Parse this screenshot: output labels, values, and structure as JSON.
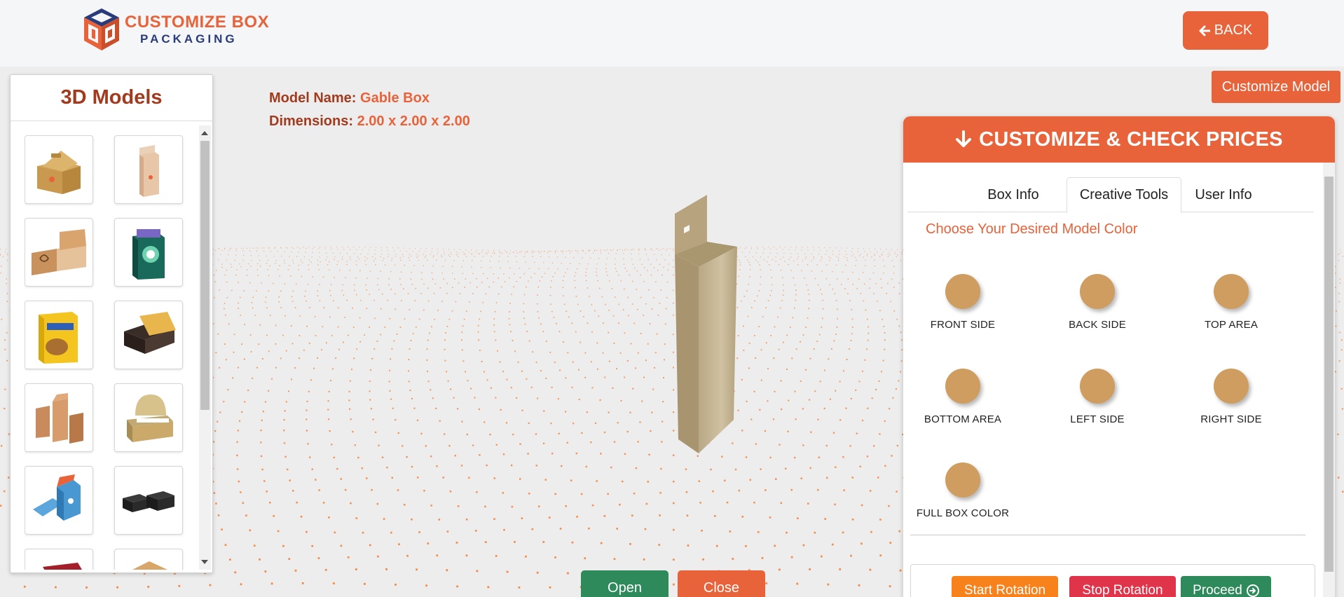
{
  "header": {
    "logo_line1": "CUSTOMIZE BOX",
    "logo_line2": "PACKAGING",
    "back_label": "BACK"
  },
  "models_panel": {
    "title": "3D Models",
    "thumbnails": [
      {
        "name": "gable-box"
      },
      {
        "name": "tuck-end-box"
      },
      {
        "name": "mailer-box"
      },
      {
        "name": "display-pack"
      },
      {
        "name": "dispenser-box"
      },
      {
        "name": "lid-box"
      },
      {
        "name": "folding-cartons"
      },
      {
        "name": "display-tray"
      },
      {
        "name": "blue-tuck-box"
      },
      {
        "name": "black-rigid-boxes"
      },
      {
        "name": "red-box"
      },
      {
        "name": "kraft-box"
      }
    ]
  },
  "model_info": {
    "name_label": "Model Name:",
    "name_value": "Gable Box",
    "dim_label": "Dimensions:",
    "dim_value": "2.00 x 2.00 x 2.00"
  },
  "viewer": {
    "open_label": "Open",
    "close_label": "Close"
  },
  "customize": {
    "model_button": "Customize Model",
    "header": "CUSTOMIZE & CHECK PRICES",
    "tabs": [
      {
        "label": "Box Info"
      },
      {
        "label": "Creative Tools"
      },
      {
        "label": "User Info"
      }
    ],
    "section_title": "Choose Your Desired Model Color",
    "swatches": [
      {
        "label": "FRONT SIDE",
        "color": "#cf9d5f"
      },
      {
        "label": "BACK SIDE",
        "color": "#cf9d5f"
      },
      {
        "label": "TOP AREA",
        "color": "#cf9d5f"
      },
      {
        "label": "BOTTOM AREA",
        "color": "#cf9d5f"
      },
      {
        "label": "LEFT SIDE",
        "color": "#cf9d5f"
      },
      {
        "label": "RIGHT SIDE",
        "color": "#cf9d5f"
      },
      {
        "label": "FULL BOX COLOR",
        "color": "#cf9d5f"
      }
    ],
    "actions": {
      "start_rotation": "Start Rotation",
      "stop_rotation": "Stop Rotation",
      "proceed": "Proceed"
    }
  },
  "colors": {
    "accent": "#e8623a",
    "title_dark": "#a23a1d",
    "green": "#2e8a5b",
    "orange": "#f7821b",
    "red": "#e0344a",
    "swatch": "#cf9d5f"
  }
}
